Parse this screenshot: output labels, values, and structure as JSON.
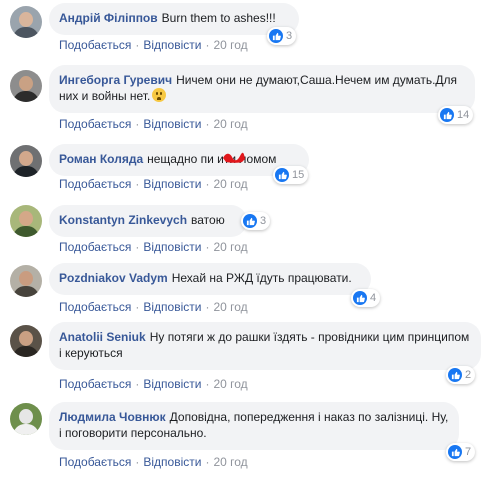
{
  "colors": {
    "link": "#385898",
    "meta": "#90949c",
    "bubble": "#f2f3f5",
    "like": "#1877f2"
  },
  "comments": [
    {
      "author": "Андрій Філіппов",
      "text": "Burn them to ashes!!!",
      "like_label": "Подобається",
      "reply_label": "Відповісти",
      "time": "20 год",
      "reactions": "3"
    },
    {
      "author": "Ингеборга Гуревич",
      "text": "Ничем они не думают,Саша.Нечем им думать.Для них и войны нет.",
      "emoji": "confused-face-icon",
      "like_label": "Подобається",
      "reply_label": "Відповісти",
      "time": "20 год",
      "reactions": "14"
    },
    {
      "author": "Роман Коляда",
      "text": "нещадно пи    ити ломом",
      "like_label": "Подобається",
      "reply_label": "Відповісти",
      "time": "20 год",
      "reactions": "15"
    },
    {
      "author": "Konstantyn Zinkevych",
      "text": "ватою",
      "like_label": "Подобається",
      "reply_label": "Відповісти",
      "time": "20 год",
      "reactions": "3"
    },
    {
      "author": "Pozdniakov Vadym",
      "text": "Нехай на РЖД їдуть працювати.",
      "like_label": "Подобається",
      "reply_label": "Відповісти",
      "time": "20 год",
      "reactions": "4"
    },
    {
      "author": "Anatolii Seniuk",
      "text": "Ну потяги ж до рашки їздять - провідники цим принципом і керуються",
      "like_label": "Подобається",
      "reply_label": "Відповісти",
      "time": "20 год",
      "reactions": "2"
    },
    {
      "author": "Людмила Човнюк",
      "text": "Доповідна, попередження і наказ по залізниці. Ну, і поговорити персонально.",
      "like_label": "Подобається",
      "reply_label": "Відповісти",
      "time": "20 год",
      "reactions": "7"
    }
  ]
}
